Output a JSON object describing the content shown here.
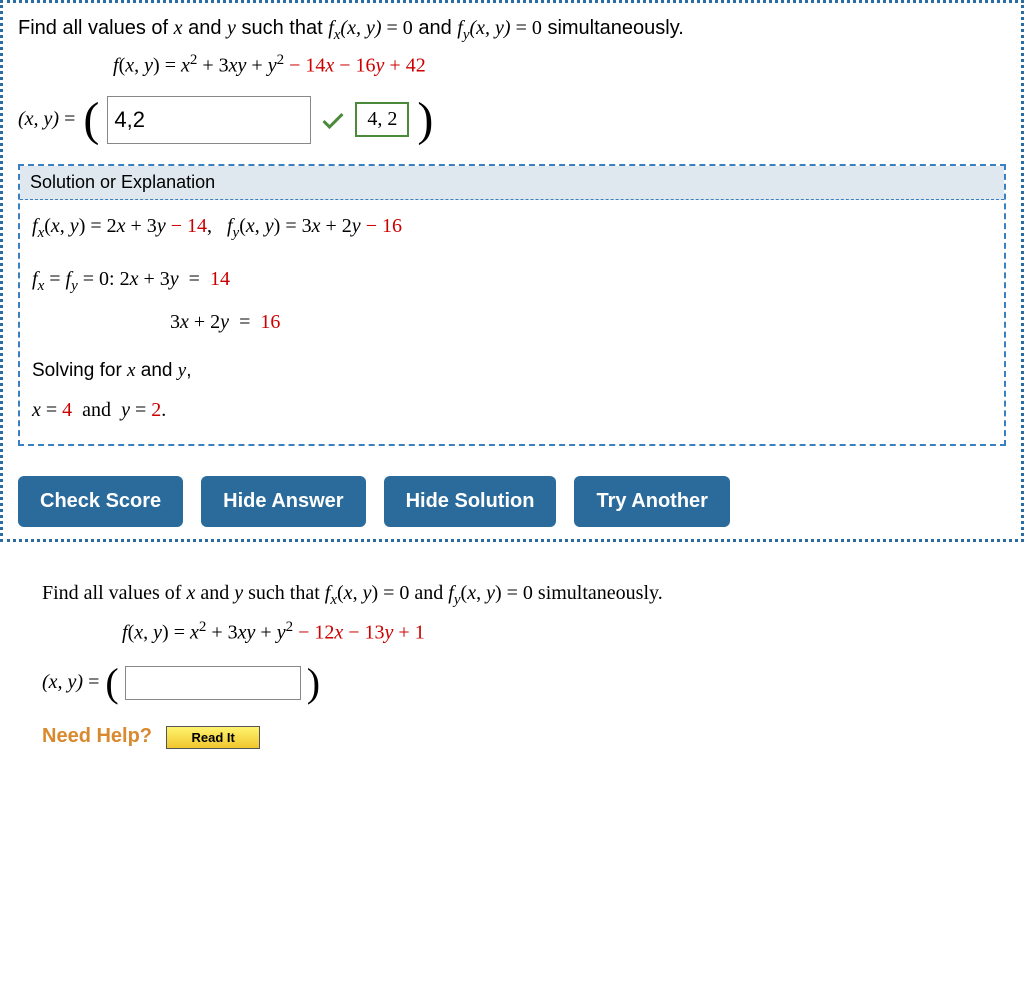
{
  "q1": {
    "prompt_pre": "Find all values of ",
    "prompt_vars": "x and y",
    "prompt_mid1": " such that  ",
    "prompt_fx": "f_x(x, y) = 0",
    "prompt_and": "  and  ",
    "prompt_fy": "f_y(x, y) = 0",
    "prompt_end": "  simultaneously.",
    "equation_lhs": "f(x, y) = x² + 3xy + y²",
    "equation_red": " − 14x − 16y + 42",
    "answer_lhs": "(x, y) = ",
    "user_answer": "4,2",
    "correct_answer": "4, 2",
    "solution_title": "Solution or Explanation",
    "sol_line1_a": "f_x(x, y) = 2x + 3y",
    "sol_line1_b": " − 14",
    "sol_line1_c": ",   f_y(x, y) = 3x + 2y",
    "sol_line1_d": " − 16",
    "sol_line2_a": "f_x = f_y = 0: 2x + 3y  =  ",
    "sol_line2_b": "14",
    "sol_line3_a": "3x + 2y  =  ",
    "sol_line3_b": "16",
    "sol_line4": "Solving for x and y,",
    "sol_line5_a": "x = ",
    "sol_line5_b": "4",
    "sol_line5_c": "  and  y = ",
    "sol_line5_d": "2",
    "sol_line5_e": ".",
    "buttons": {
      "check": "Check Score",
      "hide_ans": "Hide Answer",
      "hide_sol": "Hide Solution",
      "try": "Try Another"
    }
  },
  "q2": {
    "prompt_full": "Find all values of x and y such that f_x(x, y) = 0 and f_y(x, y) = 0 simultaneously.",
    "equation_lhs": "f(x, y) = x² + 3xy + y²",
    "equation_red": " − 12x − 13y + 1",
    "answer_lhs": "(x, y) = ",
    "need_help": "Need Help?",
    "read_it": "Read It"
  }
}
